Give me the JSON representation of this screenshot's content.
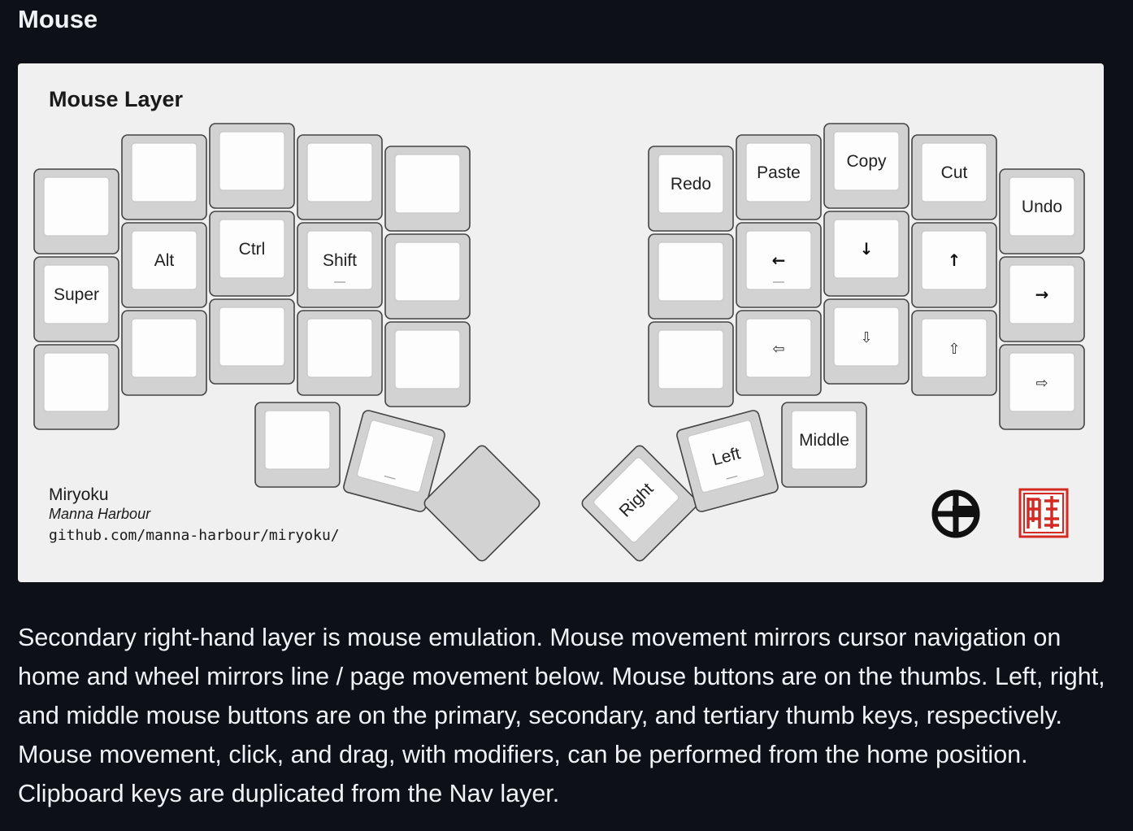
{
  "section_title": "Mouse",
  "figure": {
    "title": "Mouse Layer",
    "credit_name": "Miryoku",
    "credit_author": "Manna Harbour",
    "credit_url": "github.com/manna-harbour/miryoku/",
    "left_hand": {
      "top_row": [
        "",
        "",
        "",
        "",
        ""
      ],
      "home_row": [
        "Super",
        "Alt",
        "Ctrl",
        "Shift",
        ""
      ],
      "bottom_row": [
        "",
        "",
        "",
        "",
        ""
      ],
      "thumbs": [
        "",
        "",
        ""
      ]
    },
    "right_hand": {
      "top_row": [
        "Redo",
        "Paste",
        "Copy",
        "Cut",
        "Undo"
      ],
      "home_row": [
        "",
        "←",
        "↓",
        "↑",
        "→"
      ],
      "bottom_row": [
        "",
        "⇦",
        "⇩",
        "⇧",
        "⇨"
      ],
      "thumbs": [
        "Right",
        "Left",
        "Middle"
      ]
    },
    "logo_icons": [
      "miryoku-logo-icon",
      "manna-harbour-seal-icon"
    ]
  },
  "description": "Secondary right-hand layer is mouse emulation. Mouse movement mirrors cursor navigation on home and wheel mirrors line / page movement below. Mouse buttons are on the thumbs. Left, right, and middle mouse buttons are on the primary, secondary, and tertiary thumb keys, respectively. Mouse movement, click, and drag, with modifiers, can be performed from the home position. Clipboard keys are duplicated from the Nav layer."
}
